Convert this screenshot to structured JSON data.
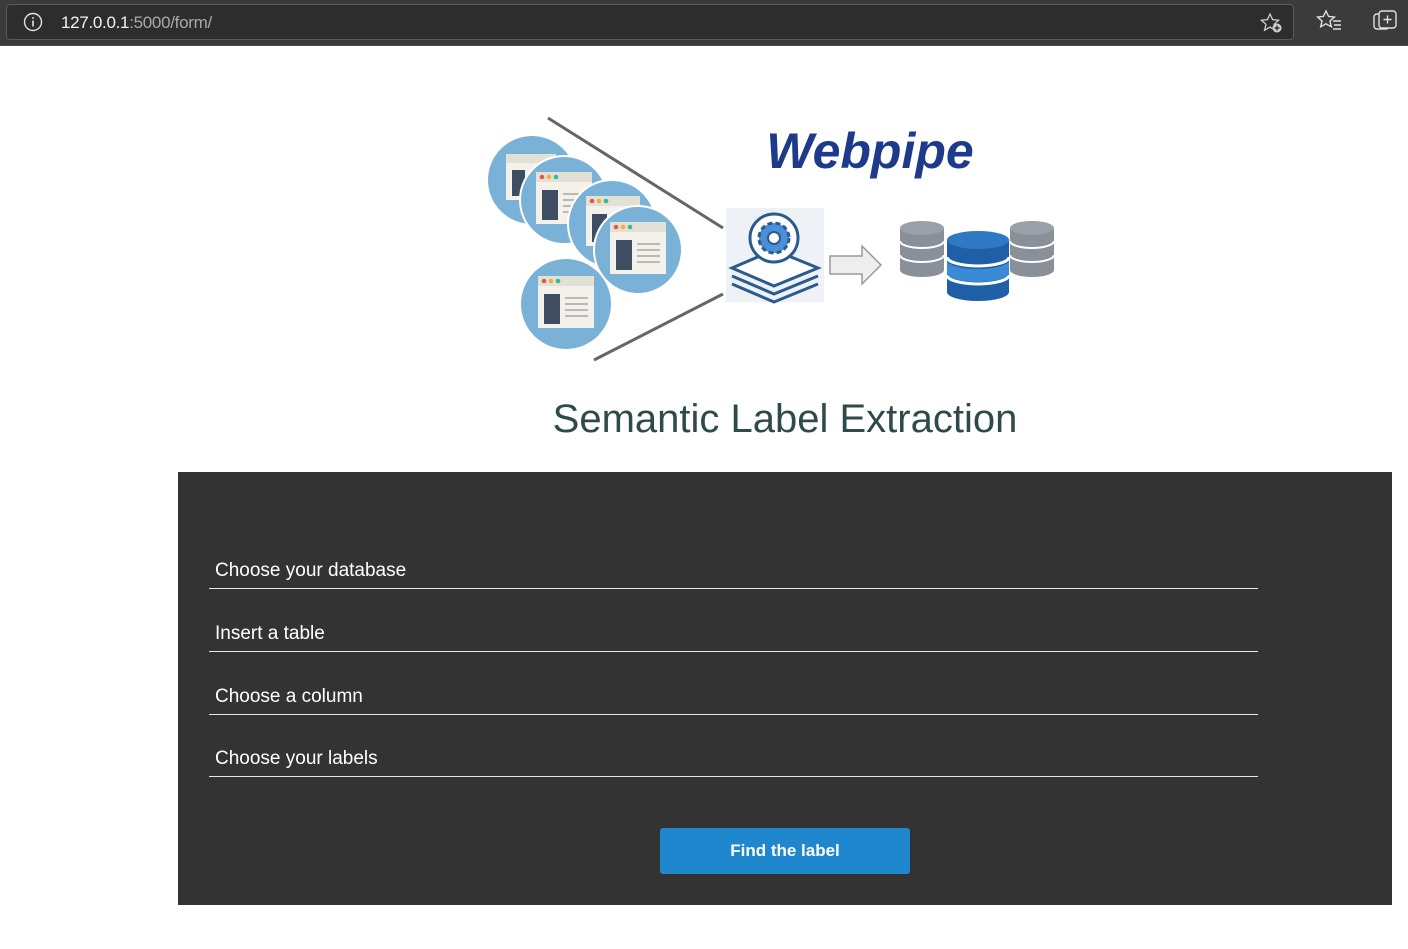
{
  "browser": {
    "url_host": "127.0.0.1",
    "url_path": ":5000/form/",
    "icons": [
      "info-icon",
      "add-favorite-icon",
      "favorites-icon",
      "collections-icon"
    ]
  },
  "hero": {
    "logo_text": "Webpipe",
    "logo_color": "#1f3a8a"
  },
  "page": {
    "title": "Semantic Label Extraction"
  },
  "form": {
    "fields": [
      {
        "placeholder": "Choose your database"
      },
      {
        "placeholder": "Insert a table"
      },
      {
        "placeholder": "Choose a column"
      },
      {
        "placeholder": "Choose your labels"
      }
    ],
    "submit_label": "Find the label"
  },
  "colors": {
    "panel_bg": "#333333",
    "button_bg": "#1f87cd",
    "title_color": "#2f4a4a"
  }
}
